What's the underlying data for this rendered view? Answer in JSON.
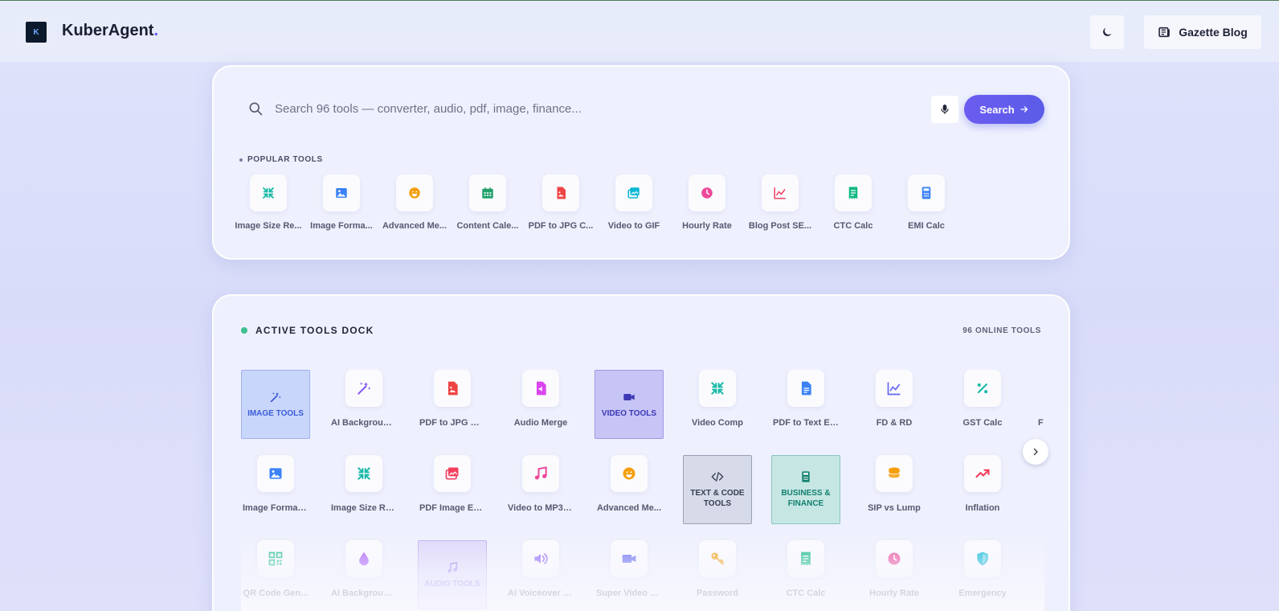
{
  "header": {
    "brand_name": "KuberAgent",
    "brand_dot": ".",
    "logo_text": "K",
    "blog_label": "Gazette Blog"
  },
  "search": {
    "placeholder": "Search 96 tools — converter, audio, pdf, image, finance...",
    "value": "",
    "button_label": "Search",
    "popular_label": "POPULAR TOOLS"
  },
  "popular": [
    {
      "label": "Image Size Re...",
      "icon": "compress-icon",
      "color": "#14b8a6"
    },
    {
      "label": "Image Forma...",
      "icon": "image-icon",
      "color": "#3b82f6"
    },
    {
      "label": "Advanced Me...",
      "icon": "emoji-icon",
      "color": "#f59e0b"
    },
    {
      "label": "Content Cale...",
      "icon": "calendar-icon",
      "color": "#22a06b"
    },
    {
      "label": "PDF to JPG C...",
      "icon": "pdf-image-icon",
      "color": "#ef4444"
    },
    {
      "label": "Video to GIF",
      "icon": "gallery-icon",
      "color": "#06b6d4"
    },
    {
      "label": "Hourly Rate",
      "icon": "clock-icon",
      "color": "#ec4899"
    },
    {
      "label": "Blog Post SE...",
      "icon": "chart-line-icon",
      "color": "#f43f5e"
    },
    {
      "label": "CTC Calc",
      "icon": "receipt-icon",
      "color": "#10b981"
    },
    {
      "label": "EMI Calc",
      "icon": "calculator-icon",
      "color": "#3b82f6"
    }
  ],
  "dock": {
    "title": "ACTIVE TOOLS DOCK",
    "count_label": "96 ONLINE TOOLS",
    "row1": [
      {
        "label": "IMAGE TOOLS",
        "kind": "category",
        "cls": "cat-image",
        "icon": "magic-wand-icon"
      },
      {
        "label": "AI Background ...",
        "icon": "magic-wand-icon",
        "color": "#8b5cf6"
      },
      {
        "label": "PDF to JPG Co...",
        "icon": "pdf-image-icon",
        "color": "#ef4444"
      },
      {
        "label": "Audio Merge",
        "icon": "audio-file-icon",
        "color": "#d946ef"
      },
      {
        "label": "VIDEO TOOLS",
        "kind": "category",
        "cls": "cat-video",
        "icon": "video-icon"
      },
      {
        "label": "Video Comp",
        "icon": "compress-icon",
        "color": "#14b8a6"
      },
      {
        "label": "PDF to Text Ex...",
        "icon": "document-icon",
        "color": "#3b82f6"
      },
      {
        "label": "FD & RD",
        "icon": "chart-line-icon",
        "color": "#6366f1"
      },
      {
        "label": "GST Calc",
        "icon": "percent-icon",
        "color": "#14b8a6"
      },
      {
        "label": "F",
        "icon": "blank-icon",
        "color": "#999"
      }
    ],
    "row2": [
      {
        "label": "Image Format ...",
        "icon": "image-icon",
        "color": "#3b82f6"
      },
      {
        "label": "Image Size Red...",
        "icon": "compress-icon",
        "color": "#14b8a6"
      },
      {
        "label": "PDF Image Ext...",
        "icon": "gallery-icon",
        "color": "#f43f5e"
      },
      {
        "label": "Video to MP3 E...",
        "icon": "music-icon",
        "color": "#ec4899"
      },
      {
        "label": "Advanced Me...",
        "icon": "emoji-icon",
        "color": "#f59e0b"
      },
      {
        "label": "TEXT & CODE TOOLS",
        "kind": "category",
        "cls": "cat-text",
        "icon": "code-icon"
      },
      {
        "label": "BUSINESS & FINANCE",
        "kind": "category",
        "cls": "cat-biz",
        "icon": "calculator-icon"
      },
      {
        "label": "SIP vs Lump",
        "icon": "coins-icon",
        "color": "#f59e0b"
      },
      {
        "label": "Inflation",
        "icon": "trend-up-icon",
        "color": "#f43f5e"
      }
    ],
    "row3": [
      {
        "label": "QR Code Gen...",
        "icon": "qr-icon",
        "color": "#10b981"
      },
      {
        "label": "AI Background ...",
        "icon": "drop-icon",
        "color": "#a855f7"
      },
      {
        "label": "AUDIO TOOLS",
        "kind": "category",
        "cls": "cat-audio",
        "icon": "music-icon"
      },
      {
        "label": "AI Voiceover (T...",
        "icon": "speaker-icon",
        "color": "#8b5cf6"
      },
      {
        "label": "Super Video E...",
        "icon": "video-icon",
        "color": "#6366f1"
      },
      {
        "label": "Password",
        "icon": "key-icon",
        "color": "#f59e0b"
      },
      {
        "label": "CTC Calc",
        "icon": "receipt-icon",
        "color": "#10b981"
      },
      {
        "label": "Hourly Rate",
        "icon": "clock-icon",
        "color": "#ec4899"
      },
      {
        "label": "Emergency",
        "icon": "shield-icon",
        "color": "#06b6d4"
      }
    ]
  }
}
